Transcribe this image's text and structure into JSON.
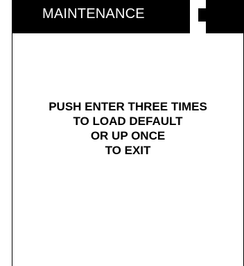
{
  "screen": {
    "title": "MAINTENANCE",
    "message_lines": [
      "PUSH ENTER THREE TIMES",
      "TO LOAD DEFAULT",
      "OR UP ONCE",
      "TO EXIT"
    ]
  },
  "colors": {
    "title_bar_bg": "#000000",
    "title_text": "#ffffff",
    "screen_bg": "#ffffff",
    "message_text": "#000000"
  },
  "icons": {
    "status_indicator": "status-indicator-icon"
  }
}
